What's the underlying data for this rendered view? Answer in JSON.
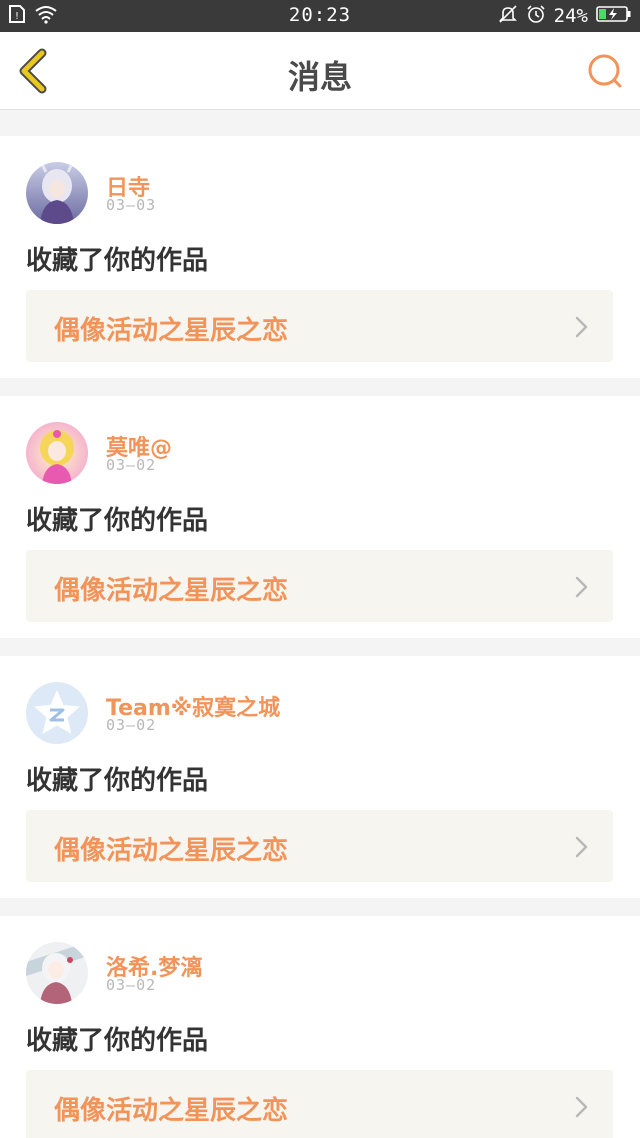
{
  "status_bar": {
    "time": "20:23",
    "battery_percent": "24%",
    "icons": [
      "sim-card-icon",
      "wifi-icon",
      "mute-icon",
      "alarm-icon",
      "battery-charging-icon"
    ]
  },
  "header": {
    "title": "消息",
    "back_icon": "chevron-left-icon",
    "search_icon": "search-icon"
  },
  "colors": {
    "accent": "#f2945a",
    "back_arrow": "#e9c71e",
    "card_bg": "#ffffff",
    "page_bg": "#f4f4f4",
    "work_row_bg": "#f6f5f0"
  },
  "messages": [
    {
      "username": "日寺",
      "date": "03—03",
      "action": "收藏了你的作品",
      "work_title": "偶像活动之星辰之恋",
      "avatar": "anime-avatar-silver-hair"
    },
    {
      "username": "莫唯@",
      "date": "03—02",
      "action": "收藏了你的作品",
      "work_title": "偶像活动之星辰之恋",
      "avatar": "anime-avatar-blonde-pink"
    },
    {
      "username": "Team※寂寞之城",
      "date": "03—02",
      "action": "收藏了你的作品",
      "work_title": "偶像活动之星辰之恋",
      "avatar": "qq-star-default-avatar"
    },
    {
      "username": "洛希.梦漓",
      "date": "03—02",
      "action": "收藏了你的作品",
      "work_title": "偶像活动之星辰之恋",
      "avatar": "anime-avatar-white-hair"
    }
  ]
}
